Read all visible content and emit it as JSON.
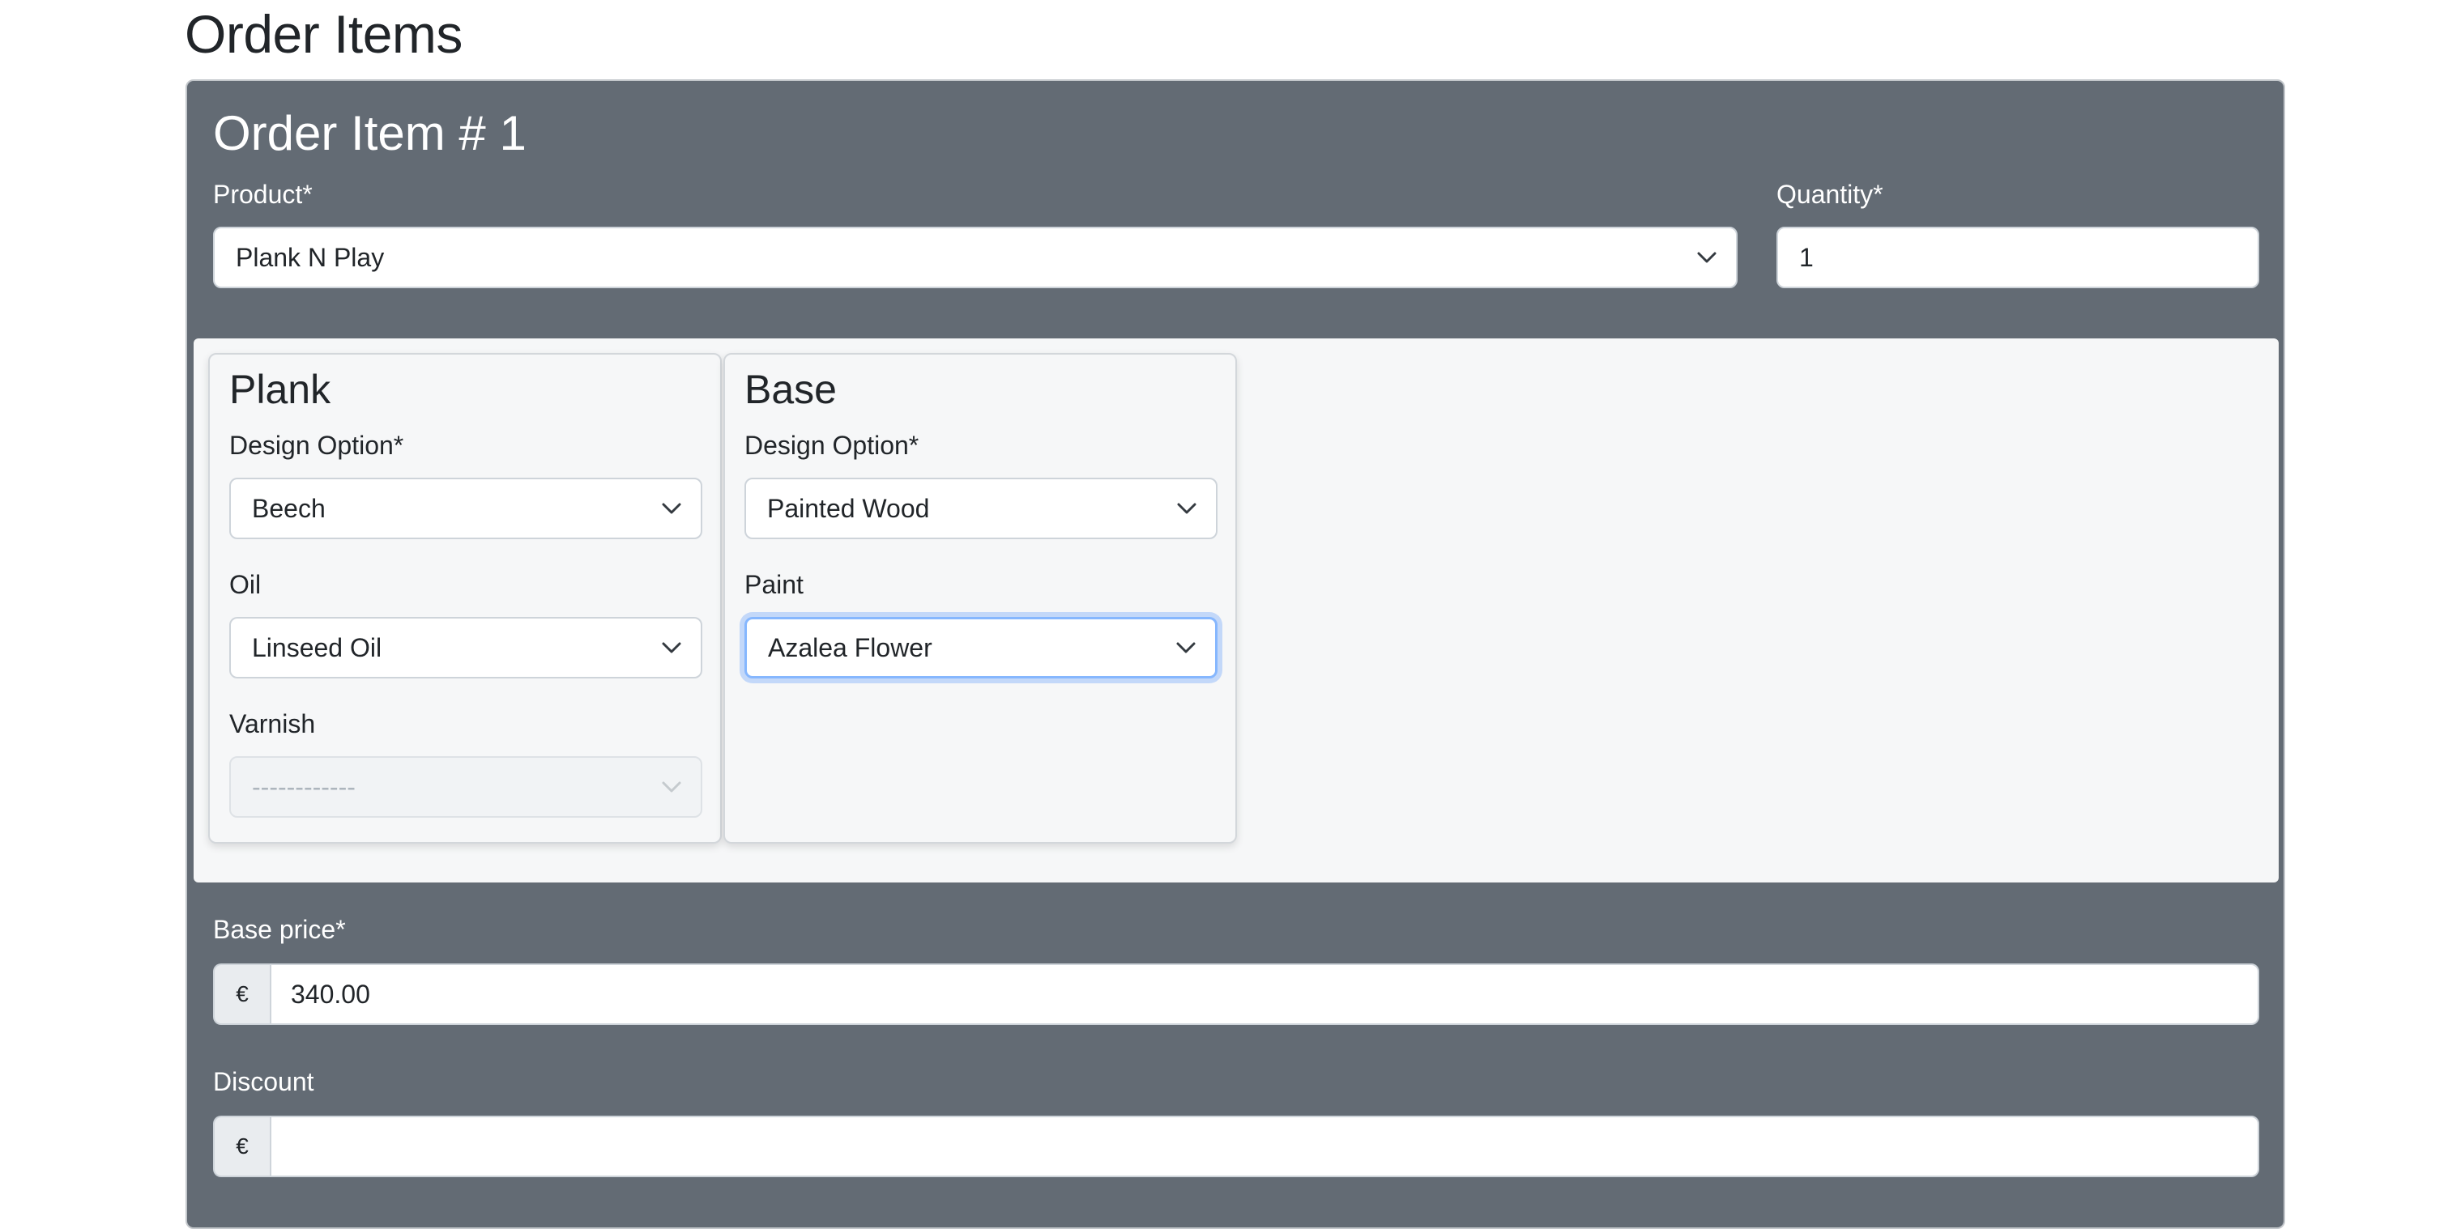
{
  "page": {
    "title": "Order Items"
  },
  "order_item": {
    "title": "Order Item # 1",
    "product": {
      "label": "Product*",
      "value": "Plank N Play"
    },
    "quantity": {
      "label": "Quantity*",
      "value": "1"
    },
    "components": [
      {
        "title": "Plank",
        "fields": [
          {
            "label": "Design Option*",
            "value": "Beech",
            "state": "normal"
          },
          {
            "label": "Oil",
            "value": "Linseed Oil",
            "state": "normal"
          },
          {
            "label": "Varnish",
            "value": "------------",
            "state": "disabled"
          }
        ]
      },
      {
        "title": "Base",
        "fields": [
          {
            "label": "Design Option*",
            "value": "Painted Wood",
            "state": "normal"
          },
          {
            "label": "Paint",
            "value": "Azalea Flower",
            "state": "focused"
          }
        ]
      }
    ],
    "base_price": {
      "label": "Base price*",
      "currency": "€",
      "value": "340.00"
    },
    "discount": {
      "label": "Discount",
      "currency": "€",
      "value": ""
    }
  },
  "icons": {
    "select_arrow": "chevron-down-icon"
  },
  "colors": {
    "card_background": "#636b74",
    "options_panel": "#f6f7f8",
    "focus_ring": "#86b7fe"
  }
}
